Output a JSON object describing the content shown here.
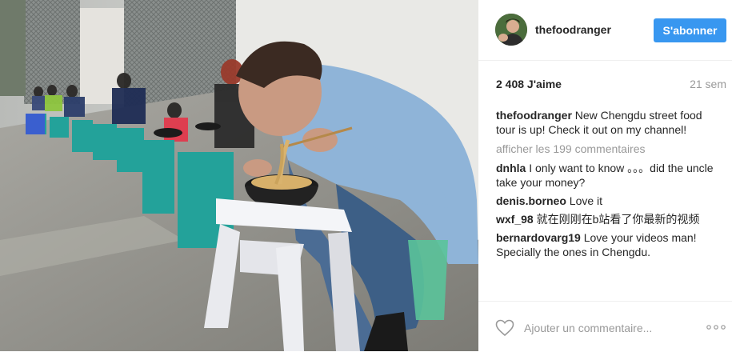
{
  "post": {
    "author": {
      "username": "thefoodranger",
      "avatar_icon": "avatar-image"
    },
    "follow_label": "S'abonner",
    "likes_text": "2 408 J'aime",
    "time_ago": "21 sem",
    "caption": {
      "username": "thefoodranger",
      "text": "New Chengdu street food tour is up! Check it out on my channel!"
    },
    "more_comments_label": "afficher les 199 commentaires",
    "comments": [
      {
        "username": "dnhla",
        "text": "I only want to know 。。。did the uncle take your money?"
      },
      {
        "username": "denis.borneo",
        "text": "Love it"
      },
      {
        "username": "wxf_98",
        "text": "就在刚刚在b站看了你最新的视频"
      },
      {
        "username": "bernardovarg19",
        "text": "Love your videos man! Specially the ones in Chengdu."
      }
    ],
    "add_comment_placeholder": "Ajouter un commentaire...",
    "icons": {
      "like": "heart-icon",
      "more": "more-options-icon"
    },
    "colors": {
      "follow_button": "#3897f0",
      "secondary_text": "#999999",
      "text": "#262626"
    }
  }
}
